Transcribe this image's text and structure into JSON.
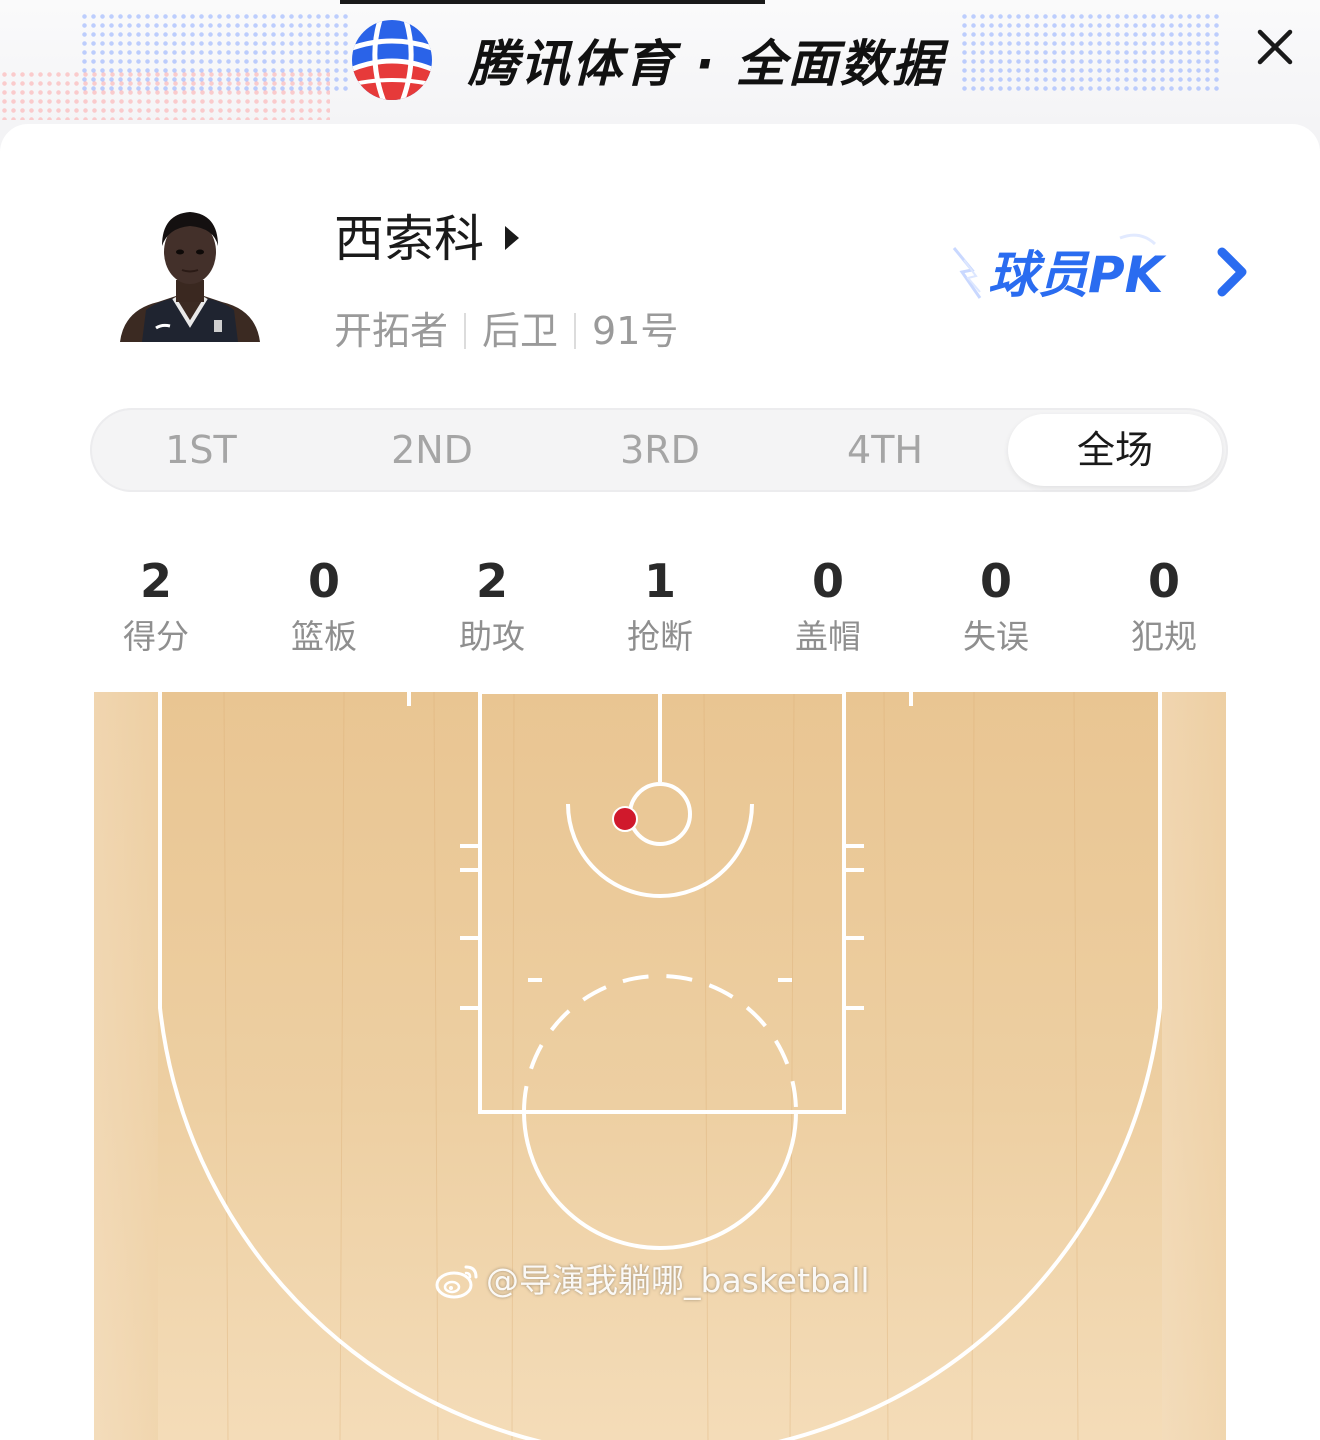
{
  "header": {
    "title": "腾讯体育 · 全面数据",
    "logo_icon": "tencent-sports-basketball-logo",
    "close_icon": "close-x-icon"
  },
  "player": {
    "name": "西索科",
    "team": "开拓者",
    "position": "后卫",
    "number": "91号",
    "avatar_icon": "player-photo",
    "pk_label": "球员PK"
  },
  "tabs": [
    {
      "label": "1ST",
      "active": false
    },
    {
      "label": "2ND",
      "active": false
    },
    {
      "label": "3RD",
      "active": false
    },
    {
      "label": "4TH",
      "active": false
    },
    {
      "label": "全场",
      "active": true
    }
  ],
  "stats": [
    {
      "value": "2",
      "label": "得分"
    },
    {
      "value": "0",
      "label": "篮板"
    },
    {
      "value": "2",
      "label": "助攻"
    },
    {
      "value": "1",
      "label": "抢断"
    },
    {
      "value": "0",
      "label": "盖帽"
    },
    {
      "value": "0",
      "label": "失误"
    },
    {
      "value": "0",
      "label": "犯规"
    }
  ],
  "court": {
    "shots": [
      {
        "result": "made",
        "zone": "restricted-area-left",
        "color": "#d0192c"
      }
    ],
    "floor_color": "#e8c08e",
    "line_color": "#ffffff"
  },
  "watermark": {
    "text": "@导演我躺哪_basketball",
    "icon": "weibo-icon"
  },
  "colors": {
    "accent_blue": "#2a6cf0",
    "brand_red": "#e03a3a",
    "text_primary": "#1a1a1a",
    "text_secondary": "#9a9a9a"
  }
}
